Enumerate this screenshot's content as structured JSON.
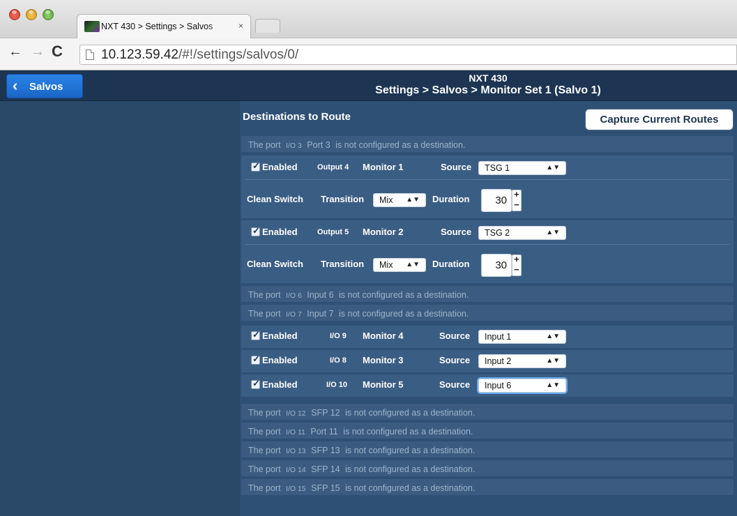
{
  "browser": {
    "tab_title": "NXT 430 > Settings > Salvos",
    "tab_close": "×",
    "url_host": "10.123.59.42",
    "url_path": "/#!/settings/salvos/0/"
  },
  "header": {
    "back_label": "Salvos",
    "device": "NXT 430",
    "breadcrumb": "Settings > Salvos > Monitor Set 1 (Salvo 1)"
  },
  "main": {
    "section_title": "Destinations to Route",
    "capture_label": "Capture Current Routes",
    "labels": {
      "enabled": "Enabled",
      "source": "Source",
      "clean_switch": "Clean Switch",
      "transition": "Transition",
      "duration": "Duration",
      "not_configured_prefix": "The port",
      "not_configured_suffix": "is not configured as a destination."
    },
    "disabled_top": {
      "io": "I/O 3",
      "name": "Port 3"
    },
    "routes_expanded": [
      {
        "port": "Output 4",
        "name": "Monitor 1",
        "source": "TSG 1",
        "transition": "Mix",
        "duration": "30"
      },
      {
        "port": "Output 5",
        "name": "Monitor 2",
        "source": "TSG 2",
        "transition": "Mix",
        "duration": "30"
      }
    ],
    "disabled_mid": [
      {
        "io": "I/O 6",
        "name": "Input 6"
      },
      {
        "io": "I/O 7",
        "name": "Input 7"
      }
    ],
    "routes_simple": [
      {
        "port": "I/O 9",
        "name": "Monitor 4",
        "source": "Input 1"
      },
      {
        "port": "I/O 8",
        "name": "Monitor 3",
        "source": "Input 2"
      },
      {
        "port": "I/O 10",
        "name": "Monitor 5",
        "source": "Input 6"
      }
    ],
    "disabled_bottom": [
      {
        "io": "I/O 12",
        "name": "SFP 12"
      },
      {
        "io": "I/O 11",
        "name": "Port 11"
      },
      {
        "io": "I/O 13",
        "name": "SFP 13"
      },
      {
        "io": "I/O 14",
        "name": "SFP 14"
      },
      {
        "io": "I/O 15",
        "name": "SFP 15"
      }
    ]
  }
}
